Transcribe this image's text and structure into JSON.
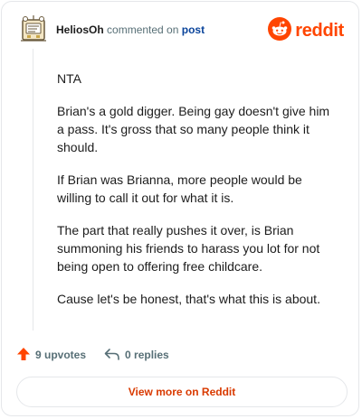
{
  "header": {
    "username": "HeliosOh",
    "action_text": "commented on",
    "post_link": "post",
    "logo_text": "reddit",
    "avatar_icon": "snoo-avatar-icon",
    "logo_icon": "reddit-snoo-icon"
  },
  "comment": {
    "paragraphs": [
      "NTA",
      "Brian's a gold digger. Being gay doesn't give him a pass. It's gross that so many people think it should.",
      "If Brian was Brianna, more people would be willing to call it out for what it is.",
      "The part that really pushes it over, is Brian summoning his friends to harass you lot for not being open to offering free childcare.",
      "Cause let's be honest, that's what this is about."
    ]
  },
  "actions": {
    "upvotes": "9 upvotes",
    "replies": "0 replies",
    "upvote_icon": "upvote-arrow-icon",
    "reply_icon": "reply-icon"
  },
  "cta": {
    "label": "View more on Reddit"
  },
  "colors": {
    "brand": "#ff4500",
    "cta_text": "#d93a00",
    "link": "#0a449b",
    "muted": "#576f76",
    "border": "#e5e7ea"
  }
}
